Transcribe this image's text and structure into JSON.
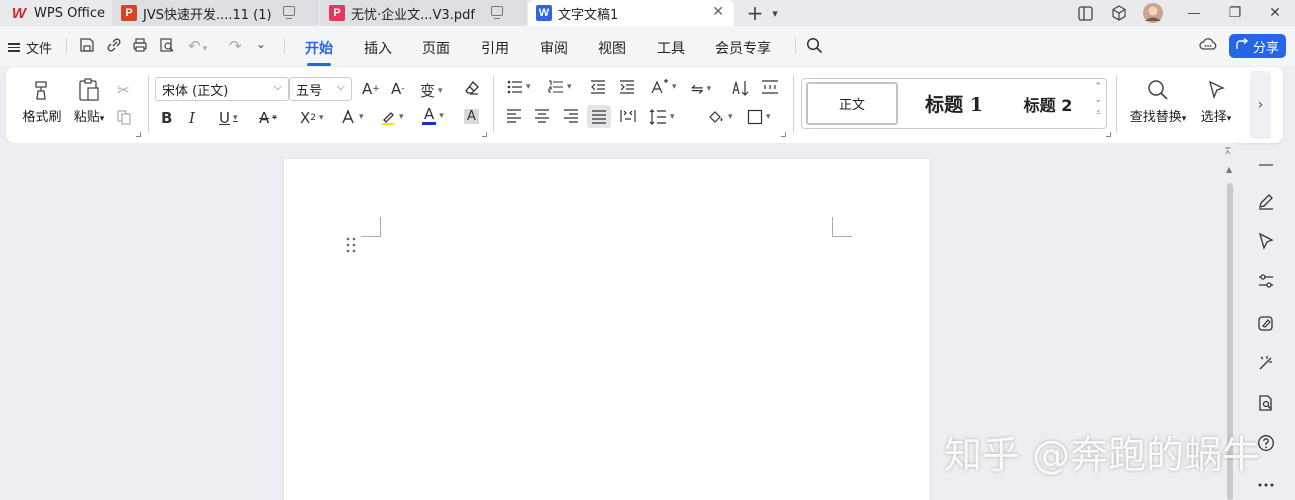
{
  "tabs": [
    {
      "label": "WPS Office",
      "icon": "wps-logo"
    },
    {
      "label": "JVS快速开发....11 (1)",
      "icon": "ppt-file-icon",
      "badge": "P"
    },
    {
      "label": "无忧·企业文...V3.pdf",
      "icon": "pdf-file-icon",
      "badge": "P"
    },
    {
      "label": "文字文稿1",
      "icon": "word-file-icon",
      "badge": "W"
    }
  ],
  "titlebar": {
    "new_tab": "+",
    "dropdown": "⌄",
    "minimize": "—",
    "maximize": "❐",
    "close": "✕"
  },
  "menubar": {
    "file_label": "文件",
    "tabs": [
      "开始",
      "插入",
      "页面",
      "引用",
      "审阅",
      "视图",
      "工具",
      "会员专享"
    ],
    "share_label": "分享"
  },
  "ribbon": {
    "format_painter": "格式刷",
    "paste": "粘贴",
    "font_name": "宋体 (正文)",
    "font_size": "五号",
    "styles": [
      "正文",
      "标题 1",
      "标题 2"
    ],
    "find_replace": "查找替换",
    "select": "选择"
  },
  "watermark": "知乎 @奔跑的蜗牛"
}
